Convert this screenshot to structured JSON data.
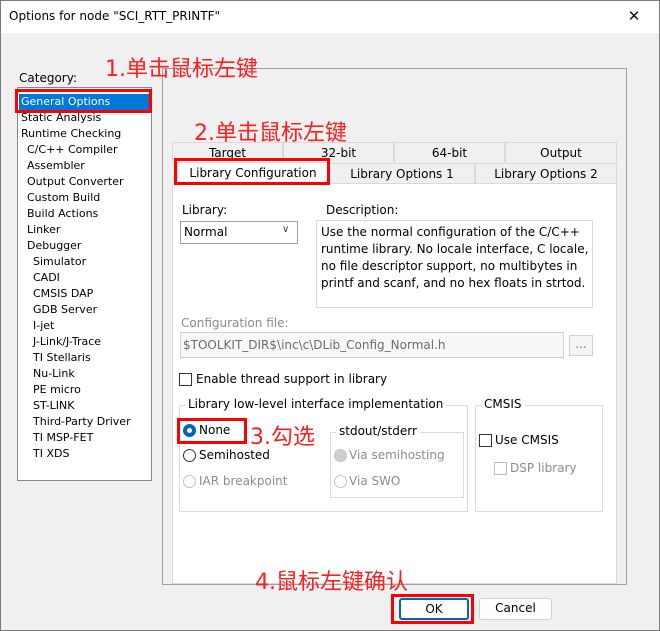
{
  "window": {
    "title": "Options for node \"SCI_RTT_PRINTF\"",
    "close_glyph": "✕"
  },
  "category": {
    "label": "Category:",
    "items": [
      {
        "label": "General Options",
        "selected": true
      },
      {
        "label": "Static Analysis"
      },
      {
        "label": "Runtime Checking"
      },
      {
        "label": "C/C++ Compiler"
      },
      {
        "label": "Assembler"
      },
      {
        "label": "Output Converter"
      },
      {
        "label": "Custom Build"
      },
      {
        "label": "Build Actions"
      },
      {
        "label": "Linker"
      },
      {
        "label": "Debugger"
      },
      {
        "label": "Simulator"
      },
      {
        "label": "CADI"
      },
      {
        "label": "CMSIS DAP"
      },
      {
        "label": "GDB Server"
      },
      {
        "label": "I-jet"
      },
      {
        "label": "J-Link/J-Trace"
      },
      {
        "label": "TI Stellaris"
      },
      {
        "label": "Nu-Link"
      },
      {
        "label": "PE micro"
      },
      {
        "label": "ST-LINK"
      },
      {
        "label": "Third-Party Driver"
      },
      {
        "label": "TI MSP-FET"
      },
      {
        "label": "TI XDS"
      }
    ]
  },
  "tabs": {
    "row1": [
      "Target",
      "32-bit",
      "64-bit",
      "Output"
    ],
    "row2": [
      "Library Configuration",
      "Library Options 1",
      "Library Options 2"
    ],
    "active": "Library Configuration"
  },
  "library": {
    "label": "Library:",
    "value": "Normal",
    "description_label": "Description:",
    "description": "Use the normal configuration of the C/C++ runtime library. No locale interface, C locale, no file descriptor support, no multibytes in printf and scanf, and no hex floats in strtod."
  },
  "config_file": {
    "label": "Configuration file:",
    "value": "$TOOLKIT_DIR$\\inc\\c\\DLib_Config_Normal.h",
    "browse_label": "..."
  },
  "thread_support": {
    "label": "Enable thread support in library",
    "checked": false
  },
  "low_level": {
    "title": "Library low-level interface implementation",
    "options": [
      {
        "label": "None",
        "checked": true,
        "enabled": true
      },
      {
        "label": "Semihosted",
        "checked": false,
        "enabled": true
      },
      {
        "label": "IAR breakpoint",
        "checked": false,
        "enabled": false
      }
    ],
    "stdout": {
      "title": "stdout/stderr",
      "options": [
        {
          "label": "Via semihosting",
          "checked": true,
          "enabled": false
        },
        {
          "label": "Via SWO",
          "checked": false,
          "enabled": false
        }
      ]
    }
  },
  "cmsis": {
    "title": "CMSIS",
    "use_cmsis": {
      "label": "Use CMSIS",
      "checked": false
    },
    "dsp_library": {
      "label": "DSP library",
      "checked": false,
      "enabled": false
    }
  },
  "buttons": {
    "ok": "OK",
    "cancel": "Cancel"
  },
  "annotations": {
    "step1": "1.单击鼠标左键",
    "step2": "2.单击鼠标左键",
    "step3": "3.勾选",
    "step4": "4.鼠标左键确认"
  },
  "colors": {
    "annotation": "#ff0000",
    "selection": "#0078d7",
    "accent": "#0067c0"
  }
}
